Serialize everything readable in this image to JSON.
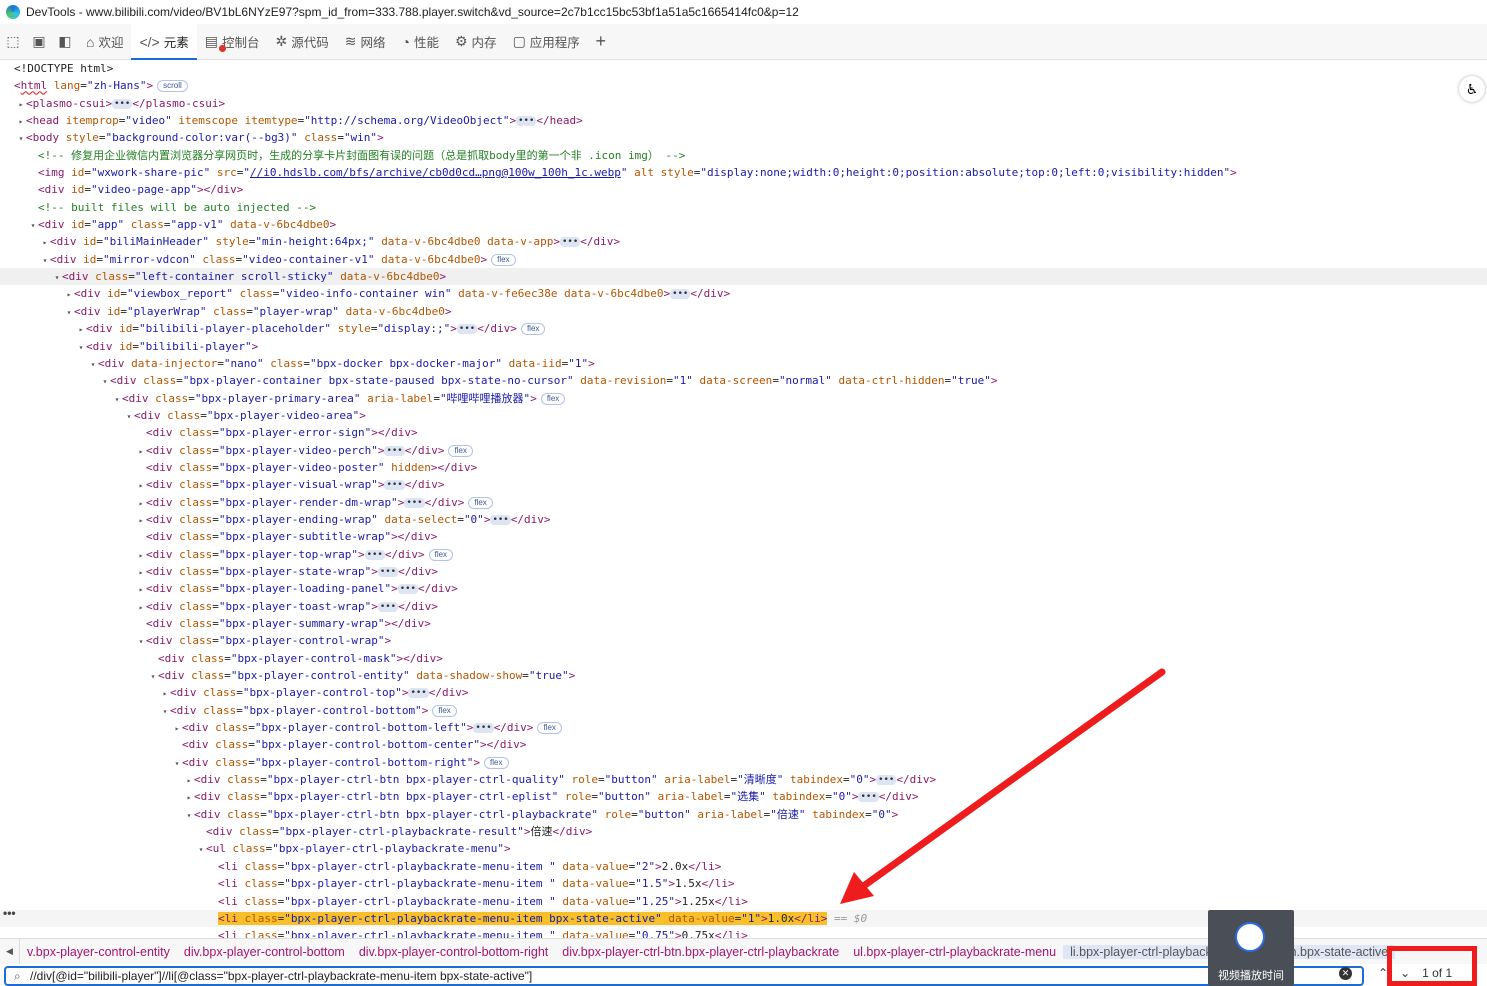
{
  "window": {
    "title": "DevTools - www.bilibili.com/video/BV1bL6NYzE97?spm_id_from=333.788.player.switch&vd_source=2c7b1cc15bc53bf1a51a5c1665414fc0&p=12"
  },
  "tabs": [
    {
      "label": "欢迎",
      "icon": "home-icon"
    },
    {
      "label": "元素",
      "icon": "code-icon",
      "active": true
    },
    {
      "label": "控制台",
      "icon": "console-icon"
    },
    {
      "label": "源代码",
      "icon": "bug-icon"
    },
    {
      "label": "网络",
      "icon": "wifi-icon"
    },
    {
      "label": "性能",
      "icon": "performance-icon"
    },
    {
      "label": "内存",
      "icon": "memory-icon"
    },
    {
      "label": "应用程序",
      "icon": "application-icon"
    }
  ],
  "tree": [
    {
      "d": 0,
      "t": "",
      "c": "<!DOCTYPE html>",
      "cls": "dt"
    },
    {
      "d": 0,
      "t": "",
      "html": "<span class=tag>&lt;<span style='text-decoration:underline wavy #d33'>html</span></span> <span class=an>lang</span>=<span class=av>\"zh-Hans\"</span><span class=tag>&gt;</span>",
      "badge": "scroll"
    },
    {
      "d": 1,
      "t": "▸",
      "html": "<span class=tag>&lt;plasmo-csui&gt;</span><span class=more>•••</span><span class=tag>&lt;/plasmo-csui&gt;</span>"
    },
    {
      "d": 1,
      "t": "▸",
      "html": "<span class=tag>&lt;head</span> <span class=an>itemprop</span>=<span class=av>\"video\"</span> <span class=an>itemscope</span> <span class=an>itemtype</span>=<span class=av>\"http://schema.org/VideoObject\"</span><span class=tag>&gt;</span><span class=more>•••</span><span class=tag>&lt;/head&gt;</span>"
    },
    {
      "d": 1,
      "t": "▾",
      "html": "<span class=tag>&lt;body</span> <span class=an>style</span>=<span class=av>\"background-color:var(--bg3)\"</span> <span class=an>class</span>=<span class=av>\"win\"</span><span class=tag>&gt;</span>"
    },
    {
      "d": 2,
      "t": "",
      "html": "<span class=cm>&lt;!-- 修复用企业微信内置浏览器分享网页时，生成的分享卡片封面图有误的问题（总是抓取body里的第一个非 .icon img） --&gt;</span>"
    },
    {
      "d": 2,
      "t": "",
      "html": "<span class=tag>&lt;img</span> <span class=an>id</span>=<span class=av>\"wxwork-share-pic\"</span> <span class=an>src</span>=<span class=av>\"<span class=link>//i0.hdslb.com/bfs/archive/cb0d0cd…png@100w_100h_1c.webp</span>\"</span> <span class=an>alt</span> <span class=an>style</span>=<span class=av>\"display:none;width:0;height:0;position:absolute;top:0;left:0;visibility:hidden\"</span><span class=tag>&gt;</span>"
    },
    {
      "d": 2,
      "t": "",
      "html": "<span class=tag>&lt;div</span> <span class=an>id</span>=<span class=av>\"video-page-app\"</span><span class=tag>&gt;&lt;/div&gt;</span>"
    },
    {
      "d": 2,
      "t": "",
      "html": "<span class=cm>&lt;!-- built files will be auto injected --&gt;</span>"
    },
    {
      "d": 2,
      "t": "▾",
      "html": "<span class=tag>&lt;div</span> <span class=an>id</span>=<span class=av>\"app\"</span> <span class=an>class</span>=<span class=av>\"app-v1\"</span> <span class=an>data-v-6bc4dbe0</span><span class=tag>&gt;</span>"
    },
    {
      "d": 3,
      "t": "▸",
      "html": "<span class=tag>&lt;div</span> <span class=an>id</span>=<span class=av>\"biliMainHeader\"</span> <span class=an>style</span>=<span class=av>\"min-height:64px;\"</span> <span class=an>data-v-6bc4dbe0</span> <span class=an>data-v-app</span><span class=tag>&gt;</span><span class=more>•••</span><span class=tag>&lt;/div&gt;</span>"
    },
    {
      "d": 3,
      "t": "▾",
      "html": "<span class=tag>&lt;div</span> <span class=an>id</span>=<span class=av>\"mirror-vdcon\"</span> <span class=an>class</span>=<span class=av>\"video-container-v1\"</span> <span class=an>data-v-6bc4dbe0</span><span class=tag>&gt;</span>",
      "badge": "flex"
    },
    {
      "d": 4,
      "t": "▾",
      "hl": true,
      "html": "<span class=tag>&lt;div</span> <span class=an>class</span>=<span class=av>\"left-container scroll-sticky\"</span> <span class=an>data-v-6bc4dbe0</span><span class=tag>&gt;</span>"
    },
    {
      "d": 5,
      "t": "▸",
      "html": "<span class=tag>&lt;div</span> <span class=an>id</span>=<span class=av>\"viewbox_report\"</span> <span class=an>class</span>=<span class=av>\"video-info-container win\"</span> <span class=an>data-v-fe6ec38e</span> <span class=an>data-v-6bc4dbe0</span><span class=tag>&gt;</span><span class=more>•••</span><span class=tag>&lt;/div&gt;</span>"
    },
    {
      "d": 5,
      "t": "▾",
      "html": "<span class=tag>&lt;div</span> <span class=an>id</span>=<span class=av>\"playerWrap\"</span> <span class=an>class</span>=<span class=av>\"player-wrap\"</span> <span class=an>data-v-6bc4dbe0</span><span class=tag>&gt;</span>"
    },
    {
      "d": 6,
      "t": "▸",
      "html": "<span class=tag>&lt;div</span> <span class=an>id</span>=<span class=av>\"bilibili-player-placeholder\"</span> <span class=an>style</span>=<span class=av>\"display:;\"</span><span class=tag>&gt;</span><span class=more>•••</span><span class=tag>&lt;/div&gt;</span>",
      "badge": "flex"
    },
    {
      "d": 6,
      "t": "▾",
      "html": "<span class=tag>&lt;div</span> <span class=an>id</span>=<span class=av>\"bilibili-player\"</span><span class=tag>&gt;</span>"
    },
    {
      "d": 7,
      "t": "▾",
      "html": "<span class=tag>&lt;div</span> <span class=an>data-injector</span>=<span class=av>\"nano\"</span> <span class=an>class</span>=<span class=av>\"bpx-docker bpx-docker-major\"</span> <span class=an>data-iid</span>=<span class=av>\"1\"</span><span class=tag>&gt;</span>"
    },
    {
      "d": 8,
      "t": "▾",
      "html": "<span class=tag>&lt;div</span> <span class=an>class</span>=<span class=av>\"bpx-player-container bpx-state-paused bpx-state-no-cursor\"</span> <span class=an>data-revision</span>=<span class=av>\"1\"</span> <span class=an>data-screen</span>=<span class=av>\"normal\"</span> <span class=an>data-ctrl-hidden</span>=<span class=av>\"true\"</span><span class=tag>&gt;</span>"
    },
    {
      "d": 9,
      "t": "▾",
      "html": "<span class=tag>&lt;div</span> <span class=an>class</span>=<span class=av>\"bpx-player-primary-area\"</span> <span class=an>aria-label</span>=<span class=av>\"哔哩哔哩播放器\"</span><span class=tag>&gt;</span>",
      "badge": "flex"
    },
    {
      "d": 10,
      "t": "▾",
      "html": "<span class=tag>&lt;div</span> <span class=an>class</span>=<span class=av>\"bpx-player-video-area\"</span><span class=tag>&gt;</span>"
    },
    {
      "d": 11,
      "t": "",
      "html": "<span class=tag>&lt;div</span> <span class=an>class</span>=<span class=av>\"bpx-player-error-sign\"</span><span class=tag>&gt;&lt;/div&gt;</span>"
    },
    {
      "d": 11,
      "t": "▸",
      "html": "<span class=tag>&lt;div</span> <span class=an>class</span>=<span class=av>\"bpx-player-video-perch\"</span><span class=tag>&gt;</span><span class=more>•••</span><span class=tag>&lt;/div&gt;</span>",
      "badge": "flex"
    },
    {
      "d": 11,
      "t": "",
      "html": "<span class=tag>&lt;div</span> <span class=an>class</span>=<span class=av>\"bpx-player-video-poster\"</span> <span class=an>hidden</span><span class=tag>&gt;&lt;/div&gt;</span>"
    },
    {
      "d": 11,
      "t": "▸",
      "html": "<span class=tag>&lt;div</span> <span class=an>class</span>=<span class=av>\"bpx-player-visual-wrap\"</span><span class=tag>&gt;</span><span class=more>•••</span><span class=tag>&lt;/div&gt;</span>"
    },
    {
      "d": 11,
      "t": "▸",
      "html": "<span class=tag>&lt;div</span> <span class=an>class</span>=<span class=av>\"bpx-player-render-dm-wrap\"</span><span class=tag>&gt;</span><span class=more>•••</span><span class=tag>&lt;/div&gt;</span>",
      "badge": "flex"
    },
    {
      "d": 11,
      "t": "▸",
      "html": "<span class=tag>&lt;div</span> <span class=an>class</span>=<span class=av>\"bpx-player-ending-wrap\"</span> <span class=an>data-select</span>=<span class=av>\"0\"</span><span class=tag>&gt;</span><span class=more>•••</span><span class=tag>&lt;/div&gt;</span>"
    },
    {
      "d": 11,
      "t": "",
      "html": "<span class=tag>&lt;div</span> <span class=an>class</span>=<span class=av>\"bpx-player-subtitle-wrap\"</span><span class=tag>&gt;&lt;/div&gt;</span>"
    },
    {
      "d": 11,
      "t": "▸",
      "html": "<span class=tag>&lt;div</span> <span class=an>class</span>=<span class=av>\"bpx-player-top-wrap\"</span><span class=tag>&gt;</span><span class=more>•••</span><span class=tag>&lt;/div&gt;</span>",
      "badge": "flex"
    },
    {
      "d": 11,
      "t": "▸",
      "html": "<span class=tag>&lt;div</span> <span class=an>class</span>=<span class=av>\"bpx-player-state-wrap\"</span><span class=tag>&gt;</span><span class=more>•••</span><span class=tag>&lt;/div&gt;</span>"
    },
    {
      "d": 11,
      "t": "▸",
      "html": "<span class=tag>&lt;div</span> <span class=an>class</span>=<span class=av>\"bpx-player-loading-panel\"</span><span class=tag>&gt;</span><span class=more>•••</span><span class=tag>&lt;/div&gt;</span>"
    },
    {
      "d": 11,
      "t": "▸",
      "html": "<span class=tag>&lt;div</span> <span class=an>class</span>=<span class=av>\"bpx-player-toast-wrap\"</span><span class=tag>&gt;</span><span class=more>•••</span><span class=tag>&lt;/div&gt;</span>"
    },
    {
      "d": 11,
      "t": "",
      "html": "<span class=tag>&lt;div</span> <span class=an>class</span>=<span class=av>\"bpx-player-summary-wrap\"</span><span class=tag>&gt;&lt;/div&gt;</span>"
    },
    {
      "d": 11,
      "t": "▾",
      "html": "<span class=tag>&lt;div</span> <span class=an>class</span>=<span class=av>\"bpx-player-control-wrap\"</span><span class=tag>&gt;</span>"
    },
    {
      "d": 12,
      "t": "",
      "html": "<span class=tag>&lt;div</span> <span class=an>class</span>=<span class=av>\"bpx-player-control-mask\"</span><span class=tag>&gt;&lt;/div&gt;</span>"
    },
    {
      "d": 12,
      "t": "▾",
      "html": "<span class=tag>&lt;div</span> <span class=an>class</span>=<span class=av>\"bpx-player-control-entity\"</span> <span class=an>data-shadow-show</span>=<span class=av>\"true\"</span><span class=tag>&gt;</span>"
    },
    {
      "d": 13,
      "t": "▸",
      "html": "<span class=tag>&lt;div</span> <span class=an>class</span>=<span class=av>\"bpx-player-control-top\"</span><span class=tag>&gt;</span><span class=more>•••</span><span class=tag>&lt;/div&gt;</span>"
    },
    {
      "d": 13,
      "t": "▾",
      "html": "<span class=tag>&lt;div</span> <span class=an>class</span>=<span class=av>\"bpx-player-control-bottom\"</span><span class=tag>&gt;</span>",
      "badge": "flex"
    },
    {
      "d": 14,
      "t": "▸",
      "html": "<span class=tag>&lt;div</span> <span class=an>class</span>=<span class=av>\"bpx-player-control-bottom-left\"</span><span class=tag>&gt;</span><span class=more>•••</span><span class=tag>&lt;/div&gt;</span>",
      "badge": "flex"
    },
    {
      "d": 14,
      "t": "",
      "html": "<span class=tag>&lt;div</span> <span class=an>class</span>=<span class=av>\"bpx-player-control-bottom-center\"</span><span class=tag>&gt;&lt;/div&gt;</span>"
    },
    {
      "d": 14,
      "t": "▾",
      "html": "<span class=tag>&lt;div</span> <span class=an>class</span>=<span class=av>\"bpx-player-control-bottom-right\"</span><span class=tag>&gt;</span>",
      "badge": "flex"
    },
    {
      "d": 15,
      "t": "▸",
      "html": "<span class=tag>&lt;div</span> <span class=an>class</span>=<span class=av>\"bpx-player-ctrl-btn bpx-player-ctrl-quality\"</span> <span class=an>role</span>=<span class=av>\"button\"</span> <span class=an>aria-label</span>=<span class=av>\"清晰度\"</span> <span class=an>tabindex</span>=<span class=av>\"0\"</span><span class=tag>&gt;</span><span class=more>•••</span><span class=tag>&lt;/div&gt;</span>"
    },
    {
      "d": 15,
      "t": "▸",
      "html": "<span class=tag>&lt;div</span> <span class=an>class</span>=<span class=av>\"bpx-player-ctrl-btn bpx-player-ctrl-eplist\"</span> <span class=an>role</span>=<span class=av>\"button\"</span> <span class=an>aria-label</span>=<span class=av>\"选集\"</span> <span class=an>tabindex</span>=<span class=av>\"0\"</span><span class=tag>&gt;</span><span class=more>•••</span><span class=tag>&lt;/div&gt;</span>"
    },
    {
      "d": 15,
      "t": "▾",
      "html": "<span class=tag>&lt;div</span> <span class=an>class</span>=<span class=av>\"bpx-player-ctrl-btn bpx-player-ctrl-playbackrate\"</span> <span class=an>role</span>=<span class=av>\"button\"</span> <span class=an>aria-label</span>=<span class=av>\"倍速\"</span> <span class=an>tabindex</span>=<span class=av>\"0\"</span><span class=tag>&gt;</span>"
    },
    {
      "d": 16,
      "t": "",
      "html": "<span class=tag>&lt;div</span> <span class=an>class</span>=<span class=av>\"bpx-player-ctrl-playbackrate-result\"</span><span class=tag>&gt;</span>倍速<span class=tag>&lt;/div&gt;</span>"
    },
    {
      "d": 16,
      "t": "▾",
      "html": "<span class=tag>&lt;ul</span> <span class=an>class</span>=<span class=av>\"bpx-player-ctrl-playbackrate-menu\"</span><span class=tag>&gt;</span>"
    },
    {
      "d": 17,
      "t": "",
      "html": "<span class=tag>&lt;li</span> <span class=an>class</span>=<span class=av>\"bpx-player-ctrl-playbackrate-menu-item \"</span> <span class=an>data-value</span>=<span class=av>\"2\"</span><span class=tag>&gt;</span>2.0x<span class=tag>&lt;/li&gt;</span>"
    },
    {
      "d": 17,
      "t": "",
      "html": "<span class=tag>&lt;li</span> <span class=an>class</span>=<span class=av>\"bpx-player-ctrl-playbackrate-menu-item \"</span> <span class=an>data-value</span>=<span class=av>\"1.5\"</span><span class=tag>&gt;</span>1.5x<span class=tag>&lt;/li&gt;</span>"
    },
    {
      "d": 17,
      "t": "",
      "html": "<span class=tag>&lt;li</span> <span class=an>class</span>=<span class=av>\"bpx-player-ctrl-playbackrate-menu-item \"</span> <span class=an>data-value</span>=<span class=av>\"1.25\"</span><span class=tag>&gt;</span>1.25x<span class=tag>&lt;/li&gt;</span>"
    },
    {
      "d": 17,
      "t": "",
      "sel": true,
      "html": "<span class=selbg><span class=tag>&lt;li</span> <span class=an>class</span>=<span class=av>\"bpx-player-ctrl-playbackrate-menu-item bpx-state-active\"</span> <span class=an>data-value</span>=<span class=av>\"1\"</span><span class=tag>&gt;</span>1.0x<span class=tag>&lt;/li&gt;</span></span> <span class=dollar>== $0</span>"
    },
    {
      "d": 17,
      "t": "",
      "html": "<span class=tag>&lt;li</span> <span class=an>class</span>=<span class=av>\"bpx-player-ctrl-playbackrate-menu-item \"</span> <span class=an>data-value</span>=<span class=av>\"0.75\"</span><span class=tag>&gt;</span>0.75x<span class=tag>&lt;/li&gt;</span>"
    }
  ],
  "breadcrumbs": [
    "v.bpx-player-control-entity",
    "div.bpx-player-control-bottom",
    "div.bpx-player-control-bottom-right",
    "div.bpx-player-ctrl-btn.bpx-player-ctrl-playbackrate",
    "ul.bpx-player-ctrl-playbackrate-menu",
    "li.bpx-player-ctrl-playbackrate-menu-item.bpx-state-active"
  ],
  "search": {
    "value": "//div[@id=\"bilibili-player\"]//li[@class=\"bpx-player-ctrl-playbackrate-menu-item bpx-state-active\"]",
    "count": "1 of 1"
  },
  "popup": {
    "label": "视频播放时间"
  },
  "colors": {
    "accent": "#1a6dd8",
    "selected": "#f7c02a",
    "annotation": "#ee1c1c"
  }
}
